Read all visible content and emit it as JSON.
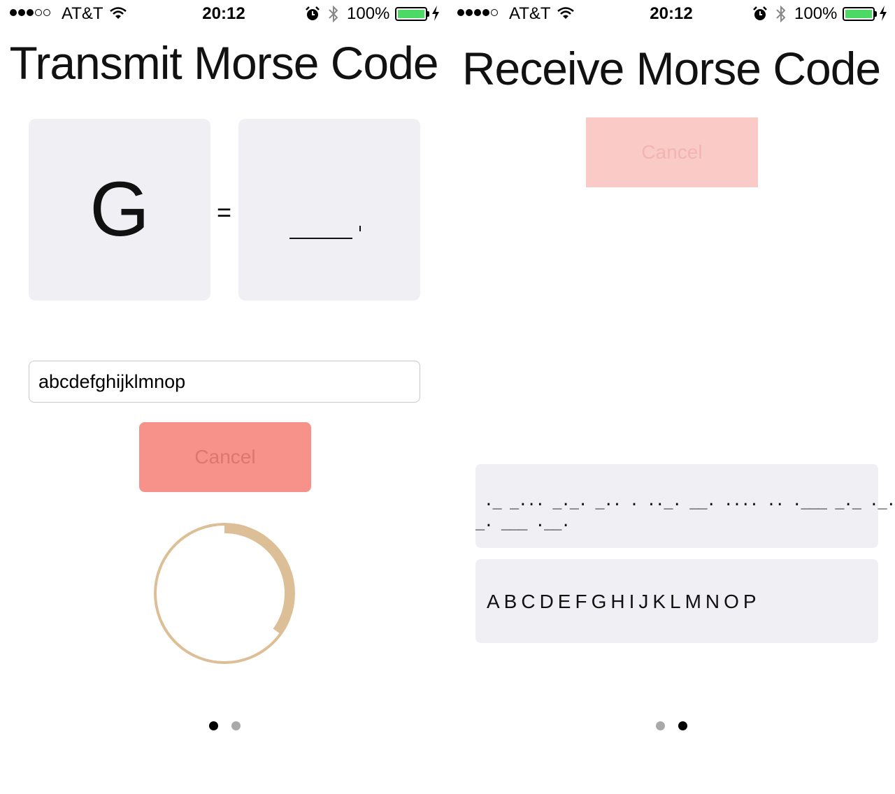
{
  "left": {
    "status": {
      "carrier": "AT&T",
      "time": "20:12",
      "battery_pct": "100%",
      "signal_bars": 3,
      "signal_total": 5
    },
    "title": "Transmit Morse Code",
    "current_letter": "G",
    "equals": "=",
    "current_morse": "_ .",
    "input": {
      "value": "abcdefghijklmnop"
    },
    "cancel_label": "Cancel",
    "progress_fraction": 0.35,
    "page_index": 0
  },
  "right": {
    "status": {
      "carrier": "AT&T",
      "time": "20:12",
      "battery_pct": "100%",
      "signal_bars": 4,
      "signal_total": 5
    },
    "title": "Receive Morse Code",
    "cancel_label": "Cancel",
    "morse_lines": [
      " ._ _... _._. _.. . .._. __. .... .. .___ _._ ._.. __",
      "_. ___ .__."
    ],
    "decoded_text": "ABCDEFGHIJKLMNOP",
    "page_index": 1
  },
  "colors": {
    "box_gray": "#efeff4",
    "cancel_active": "#f7928a",
    "cancel_disabled": "#f9cac6",
    "progress_ring": "#dcbf97",
    "battery_green": "#4cd964"
  }
}
